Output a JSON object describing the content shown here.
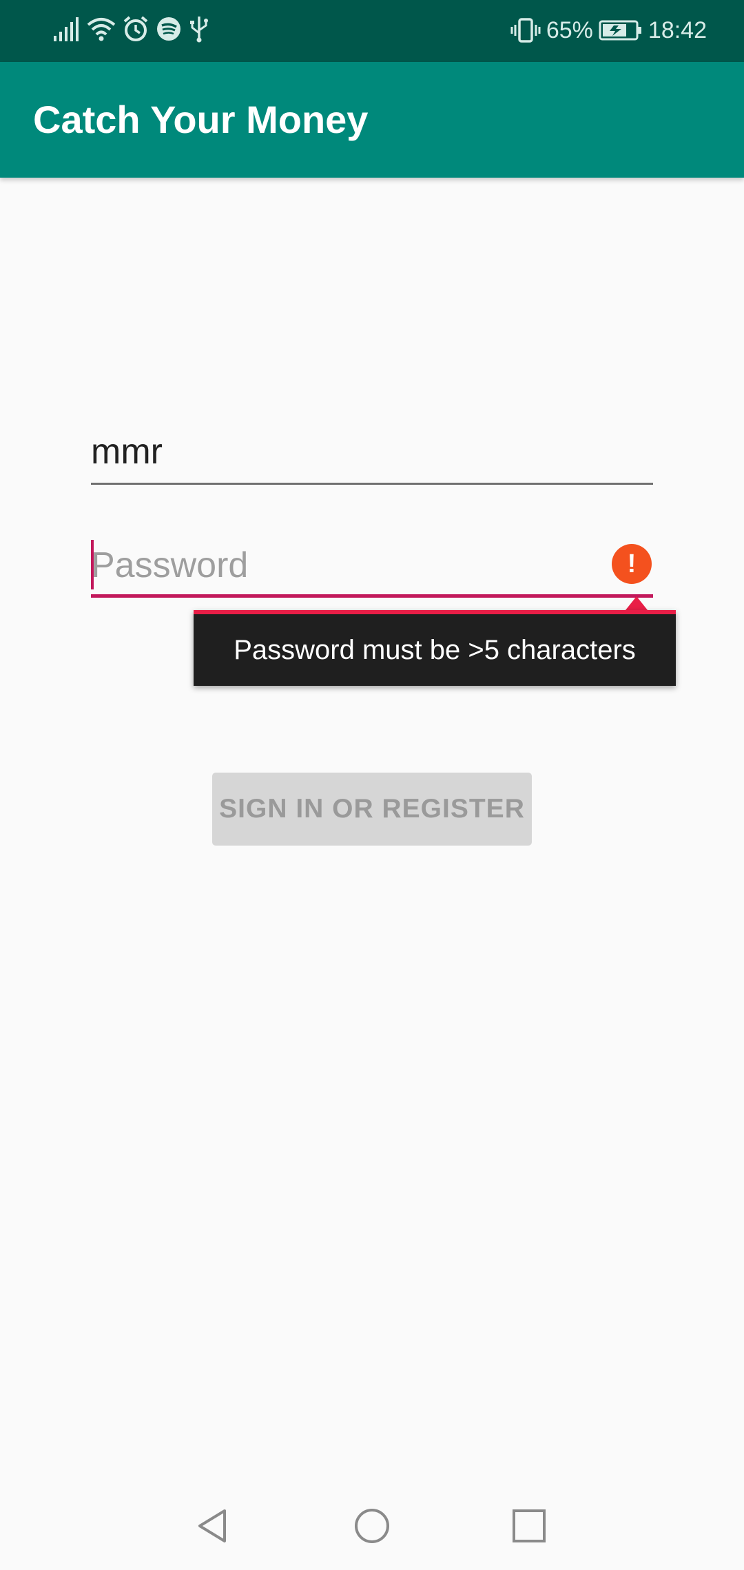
{
  "status_bar": {
    "battery_percent": "65%",
    "time": "18:42",
    "left_icons": [
      "signal-icon",
      "wifi-icon",
      "alarm-icon",
      "spotify-icon",
      "usb-icon"
    ],
    "right_icons": [
      "vibrate-icon",
      "battery-charging-icon"
    ]
  },
  "app_bar": {
    "title": "Catch Your Money",
    "color": "#00897b"
  },
  "form": {
    "username_value": "mmr",
    "password_value": "",
    "password_placeholder": "Password",
    "password_error": "Password must be >5 characters",
    "submit_label": "SIGN IN OR REGISTER",
    "submit_enabled": false
  },
  "colors": {
    "status_bar": "#00574b",
    "accent": "#c2185b",
    "error_icon": "#f4511e",
    "error_popup_border": "#e91e47"
  },
  "nav_bar": {
    "icons": [
      "back-icon",
      "home-icon",
      "recents-icon"
    ]
  }
}
